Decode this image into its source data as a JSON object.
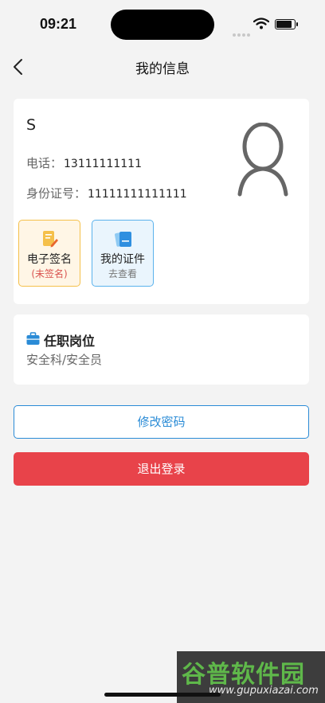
{
  "status_bar": {
    "time": "09:21",
    "battery_level": 0.9
  },
  "nav": {
    "title": "我的信息"
  },
  "profile": {
    "name": "S",
    "phone_label": "电话：",
    "phone": "13111111111",
    "id_label": "身份证号：",
    "id_number": "11111111111111"
  },
  "tiles": {
    "signature": {
      "label": "电子签名",
      "status": "(未签名)",
      "icon": "signature-pen-icon",
      "color": "#f5c04a"
    },
    "certificates": {
      "label": "我的证件",
      "action": "去查看",
      "icon": "certificate-stack-icon",
      "color": "#5ab2ec"
    }
  },
  "position": {
    "icon": "briefcase-icon",
    "title": "任职岗位",
    "value": "安全科/安全员"
  },
  "buttons": {
    "change_password": "修改密码",
    "logout": "退出登录"
  },
  "colors": {
    "primary": "#2a8bd6",
    "danger": "#e8434a"
  },
  "watermark": {
    "brand": "谷普软件园",
    "domain": "www.gupuxiazai.com"
  }
}
